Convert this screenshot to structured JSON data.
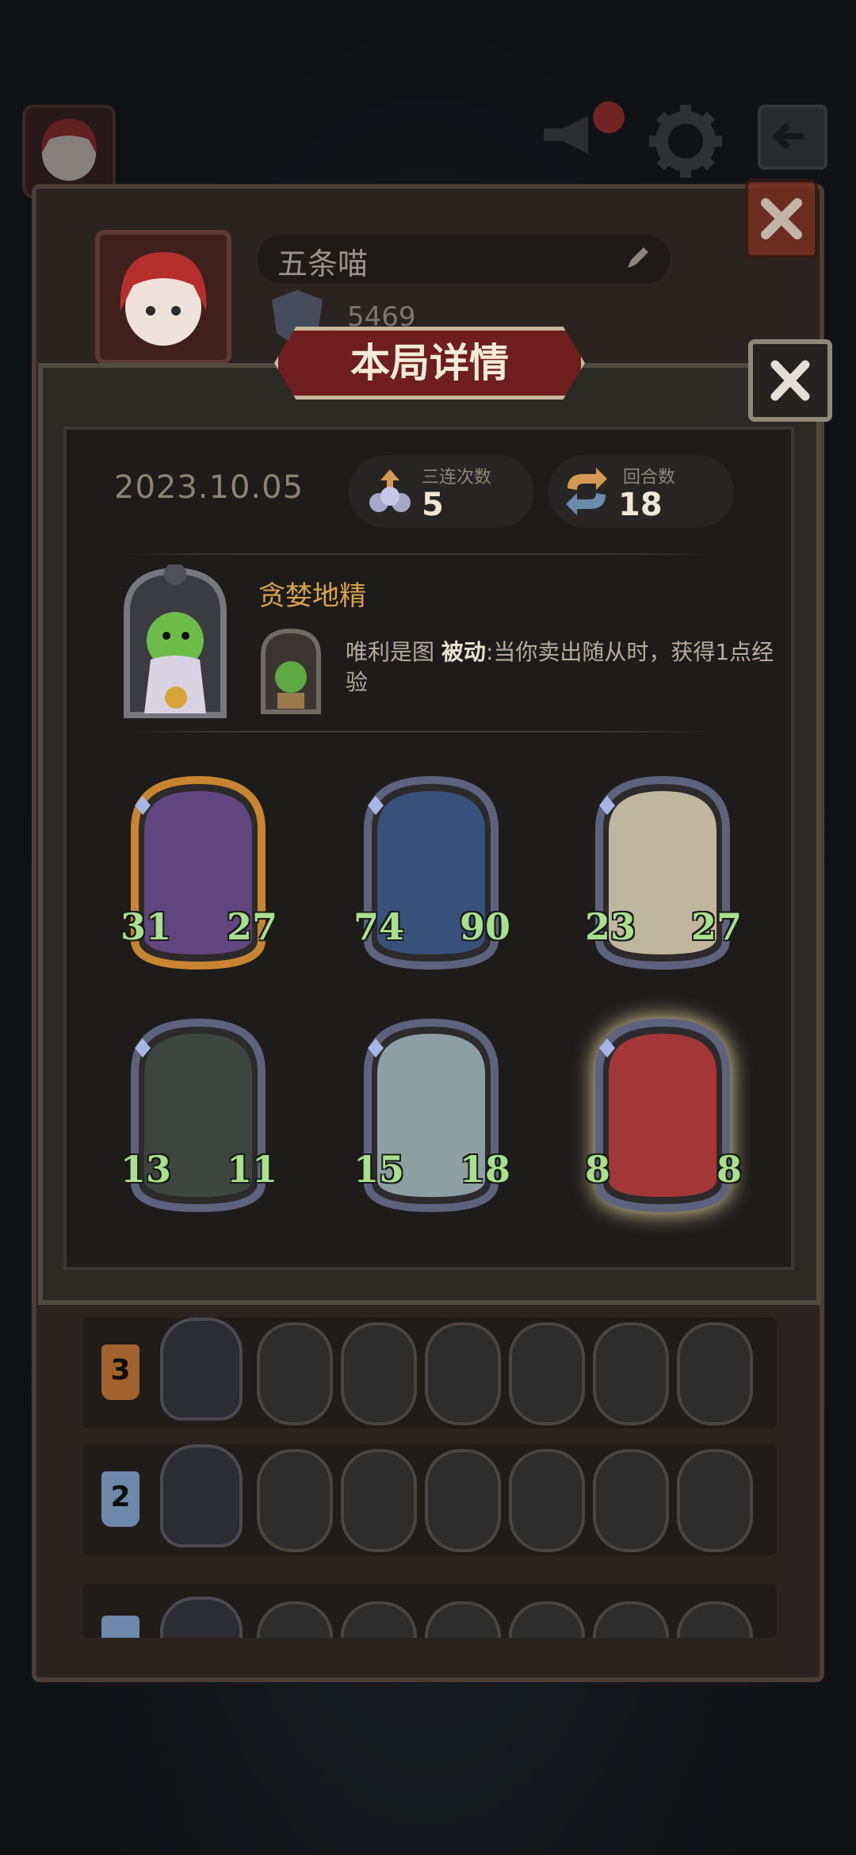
{
  "profile": {
    "name": "五条喵",
    "score": "5469"
  },
  "dialog": {
    "title": "本局详情",
    "date": "2023.10.05",
    "stats": [
      {
        "label": "三连次数",
        "value": "5"
      },
      {
        "label": "回合数",
        "value": "18"
      }
    ],
    "hero": {
      "name": "贪婪地精",
      "power_name": "唯利是图",
      "power_type": "被动",
      "power_desc": ":当你卖出随从时，获得1点经验"
    },
    "minions": [
      {
        "attack": "31",
        "health": "27",
        "frame": "gold",
        "subject": "dragon"
      },
      {
        "attack": "74",
        "health": "90",
        "frame": "silver",
        "subject": "knight"
      },
      {
        "attack": "23",
        "health": "27",
        "frame": "silver",
        "subject": "bone-dragon"
      },
      {
        "attack": "13",
        "health": "11",
        "frame": "silver",
        "subject": "reaper"
      },
      {
        "attack": "15",
        "health": "18",
        "frame": "silver",
        "subject": "beast"
      },
      {
        "attack": "8",
        "health": "8",
        "frame": "glowing",
        "subject": "clown"
      }
    ]
  },
  "history": [
    {
      "rank": "3",
      "rank_color": "#a2622d"
    },
    {
      "rank": "2",
      "rank_color": "#6d88a8"
    },
    {
      "rank": "",
      "rank_color": "#6d88a8"
    }
  ],
  "colors": {
    "accent_gold": "#d8a14c",
    "stat_green": "#a8e08e",
    "banner_red": "#6e1f1d"
  }
}
